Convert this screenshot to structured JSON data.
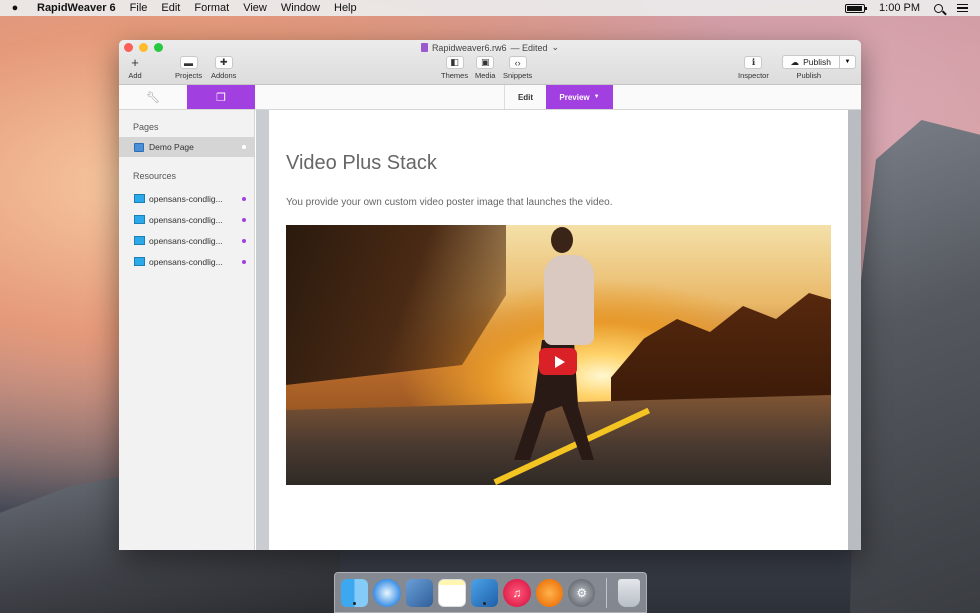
{
  "menubar": {
    "app_name": "RapidWeaver 6",
    "items": [
      "File",
      "Edit",
      "Format",
      "View",
      "Window",
      "Help"
    ],
    "clock": "1:00 PM"
  },
  "window": {
    "doc_title": "Rapidweaver6.rw6",
    "doc_status": "— Edited",
    "toolbar": {
      "add": "Add",
      "projects": "Projects",
      "addons": "Addons",
      "themes": "Themes",
      "media": "Media",
      "snippets": "Snippets",
      "inspector": "Inspector",
      "publish_button": "Publish",
      "publish_label": "Publish"
    },
    "tabs": {
      "edit": "Edit",
      "preview": "Preview"
    }
  },
  "sidebar": {
    "pages_heading": "Pages",
    "pages": [
      {
        "label": "Demo Page"
      }
    ],
    "resources_heading": "Resources",
    "resources": [
      {
        "label": "opensans-condlig..."
      },
      {
        "label": "opensans-condlig..."
      },
      {
        "label": "opensans-condlig..."
      },
      {
        "label": "opensans-condlig..."
      }
    ]
  },
  "content": {
    "heading": "Video Plus Stack",
    "description": "You provide your own custom video poster image that launches the video."
  },
  "colors": {
    "accent": "#a23fe0",
    "play_button": "#d92127"
  },
  "dock": {
    "items": [
      "finder-icon",
      "safari-icon",
      "mail-icon",
      "notes-icon",
      "rapidweaver-icon",
      "itunes-icon",
      "ibooks-icon",
      "system-preferences-icon",
      "trash-icon"
    ]
  }
}
